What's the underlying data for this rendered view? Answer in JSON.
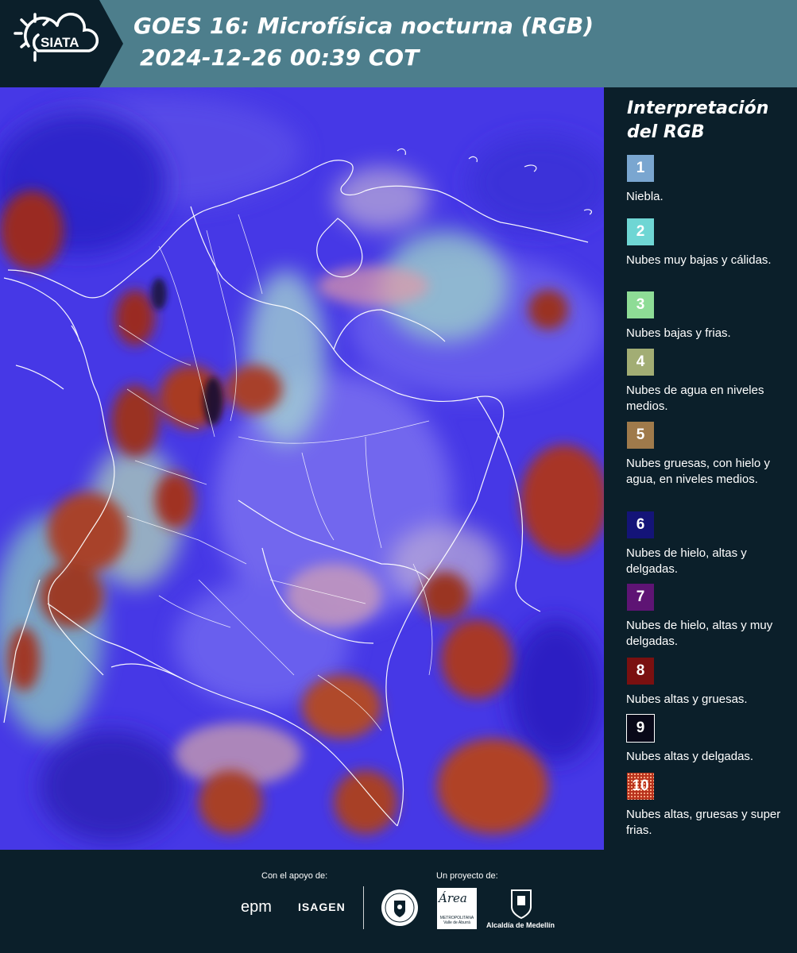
{
  "header": {
    "logo_text": "SIATA",
    "title_line1": "GOES 16: Microfísica nocturna (RGB)",
    "title_line2": "2024-12-26 00:39 COT"
  },
  "legend": {
    "title_line1": "Interpretación",
    "title_line2": "del RGB",
    "items": [
      {
        "number": "1",
        "color": "#7aa6d0",
        "text": "Niebla."
      },
      {
        "number": "2",
        "color": "#6fd6d4",
        "text": "Nubes muy bajas y cálidas."
      },
      {
        "number": "3",
        "color": "#8edc96",
        "text": "Nubes bajas y frias."
      },
      {
        "number": "4",
        "color": "#a2ad74",
        "text": "Nubes de agua en niveles medios."
      },
      {
        "number": "5",
        "color": "#9f7a4b",
        "text": "Nubes gruesas, con hielo y agua, en niveles medios."
      },
      {
        "number": "6",
        "color": "#141478",
        "text": "Nubes de hielo, altas y delgadas."
      },
      {
        "number": "7",
        "color": "#5e1474",
        "text": "Nubes de hielo, altas y muy delgadas."
      },
      {
        "number": "8",
        "color": "#7a1010",
        "text": "Nubes altas y gruesas."
      },
      {
        "number": "9",
        "color": "#080818",
        "text": "Nubes altas y delgadas."
      },
      {
        "number": "10",
        "color": "#b8321c",
        "text": "Nubes altas, gruesas y super frias."
      }
    ]
  },
  "footer": {
    "support_label": "Con el apoyo de:",
    "project_label": "Un proyecto de:",
    "sponsor_1": "epm",
    "sponsor_2": "ISAGEN",
    "area_logo_text": "Área",
    "area_logo_sub": "METROPOLITANA Valle de Aburrá",
    "alcaldia_text": "Alcaldía de Medellín"
  }
}
